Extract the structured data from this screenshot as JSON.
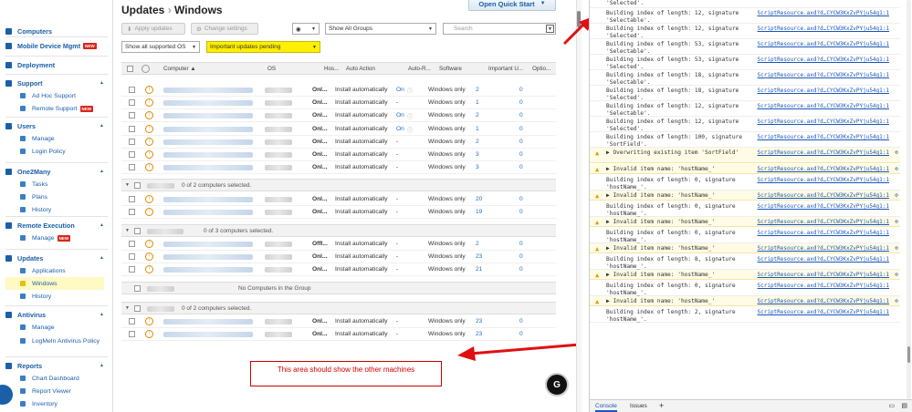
{
  "sidebar": {
    "sections": [
      {
        "label": "Computers",
        "items": []
      },
      {
        "label": "Mobile Device Mgmt",
        "badge": "NEW",
        "items": []
      },
      {
        "label": "Deployment",
        "items": []
      },
      {
        "label": "Support",
        "items": [
          {
            "label": "Ad Hoc Support"
          },
          {
            "label": "Remote Support",
            "badge": "NEW"
          }
        ]
      },
      {
        "label": "Users",
        "items": [
          {
            "label": "Manage"
          },
          {
            "label": "Login Policy"
          }
        ]
      },
      {
        "label": "One2Many",
        "items": [
          {
            "label": "Tasks"
          },
          {
            "label": "Plans"
          },
          {
            "label": "History"
          }
        ]
      },
      {
        "label": "Remote Execution",
        "items": [
          {
            "label": "Manage",
            "badge": "NEW"
          }
        ]
      },
      {
        "label": "Updates",
        "items": [
          {
            "label": "Applications"
          },
          {
            "label": "Windows",
            "active": true
          },
          {
            "label": "History"
          }
        ]
      },
      {
        "label": "Antivirus",
        "items": [
          {
            "label": "Manage"
          },
          {
            "label": "LogMeIn Antivirus Policy"
          }
        ]
      },
      {
        "label": "Reports",
        "items": [
          {
            "label": "Chart Dashboard"
          },
          {
            "label": "Report Viewer"
          },
          {
            "label": "Inventory"
          }
        ]
      }
    ]
  },
  "page": {
    "title": "Updates",
    "title_sep": "›",
    "subtitle": "Windows",
    "quick_start": "Open Quick Start"
  },
  "toolbar": {
    "apply": "Apply updates",
    "change": "Change settings",
    "group_select": "Show All Groups",
    "os_select": "Show all supported OS",
    "filter_select": "Important updates pending",
    "search_placeholder": "Search"
  },
  "table": {
    "headers": [
      "Computer ▲",
      "OS",
      "Hos...",
      "Auto Action",
      "Auto-R...",
      "Software",
      "Important U...",
      "Optio..."
    ],
    "rows": [
      {
        "status": "Onl...",
        "action": "Install automatically",
        "autor": "On",
        "autor_info": true,
        "software": "Windows only",
        "important": "2",
        "optional": "0"
      },
      {
        "status": "Onl...",
        "action": "Install automatically",
        "autor": "-",
        "autor_info": false,
        "software": "Windows only",
        "important": "1",
        "optional": "0"
      },
      {
        "status": "Onl...",
        "action": "Install automatically",
        "autor": "On",
        "autor_info": true,
        "software": "Windows only",
        "important": "2",
        "optional": "0"
      },
      {
        "status": "Onl...",
        "action": "Install automatically",
        "autor": "On",
        "autor_info": true,
        "software": "Windows only",
        "important": "1",
        "optional": "0"
      },
      {
        "status": "Onl...",
        "action": "Install automatically",
        "autor": "-",
        "autor_info": false,
        "software": "Windows only",
        "important": "2",
        "optional": "0"
      },
      {
        "status": "Onl...",
        "action": "Install automatically",
        "autor": "-",
        "autor_info": false,
        "software": "Windows only",
        "important": "3",
        "optional": "0"
      },
      {
        "status": "Onl...",
        "action": "Install automatically",
        "autor": "-",
        "autor_info": false,
        "software": "Windows only",
        "important": "3",
        "optional": "0"
      }
    ],
    "groups": [
      {
        "label": "0 of 2 computers selected.",
        "rows": [
          {
            "status": "Onl...",
            "action": "Install automatically",
            "autor": "-",
            "software": "Windows only",
            "important": "20",
            "optional": "0"
          },
          {
            "status": "Onl...",
            "action": "Install automatically",
            "autor": "-",
            "software": "Windows only",
            "important": "19",
            "optional": "0"
          }
        ]
      },
      {
        "label": "0 of 3 computers selected.",
        "rows": [
          {
            "status": "Offl...",
            "action": "Install automatically",
            "autor": "-",
            "software": "Windows only",
            "important": "2",
            "optional": "0"
          },
          {
            "status": "Onl...",
            "action": "Install automatically",
            "autor": "-",
            "software": "Windows only",
            "important": "23",
            "optional": "0"
          },
          {
            "status": "Onl...",
            "action": "Install automatically",
            "autor": "-",
            "software": "Windows only",
            "important": "21",
            "optional": "0"
          }
        ]
      },
      {
        "label": "No Computers in the Group",
        "rows": []
      },
      {
        "label": "0 of 2 computers selected.",
        "rows": [
          {
            "status": "Onl...",
            "action": "Install automatically",
            "autor": "-",
            "software": "Windows only",
            "important": "23",
            "optional": "0"
          },
          {
            "status": "Onl...",
            "action": "Install automatically",
            "autor": "-",
            "software": "Windows only",
            "important": "23",
            "optional": "0"
          }
        ]
      }
    ]
  },
  "annotation": {
    "text": "This area should show the other machines"
  },
  "devtools": {
    "logs": [
      {
        "type": "log",
        "text": "'Selected'.",
        "src": ""
      },
      {
        "type": "log",
        "text": "Building index of length: 12, signature 'Selectable'.",
        "src": "ScriptResource.axd?d…CYCW3KxZvPYju54g1:1"
      },
      {
        "type": "log",
        "text": "Building index of length: 12, signature 'Selected'.",
        "src": "ScriptResource.axd?d…CYCW3KxZvPYju54g1:1"
      },
      {
        "type": "log",
        "text": "Building index of length: 53, signature 'Selectable'.",
        "src": "ScriptResource.axd?d…CYCW3KxZvPYju54g1:1"
      },
      {
        "type": "log",
        "text": "Building index of length: 53, signature 'Selected'.",
        "src": "ScriptResource.axd?d…CYCW3KxZvPYju54g1:1"
      },
      {
        "type": "log",
        "text": "Building index of length: 18, signature 'Selectable'.",
        "src": "ScriptResource.axd?d…CYCW3KxZvPYju54g1:1"
      },
      {
        "type": "log",
        "text": "Building index of length: 18, signature 'Selected'.",
        "src": "ScriptResource.axd?d…CYCW3KxZvPYju54g1:1"
      },
      {
        "type": "log",
        "text": "Building index of length: 12, signature 'Selectable'.",
        "src": "ScriptResource.axd?d…CYCW3KxZvPYju54g1:1"
      },
      {
        "type": "log",
        "text": "Building index of length: 12, signature 'Selected'.",
        "src": "ScriptResource.axd?d…CYCW3KxZvPYju54g1:1"
      },
      {
        "type": "log",
        "text": "Building index of length: 100, signature 'SortField'.",
        "src": "ScriptResource.axd?d…CYCW3KxZvPYju54g1:1"
      },
      {
        "type": "warn",
        "text": "▶ Overwriting existing item 'SortField'",
        "src": "ScriptResource.axd?d…CYCW3KxZvPYju54g1:1"
      },
      {
        "type": "warn",
        "text": "▶ Invalid item name: 'hostName_'",
        "src": "ScriptResource.axd?d…CYCW3KxZvPYju54g1:1"
      },
      {
        "type": "log",
        "text": "Building index of length: 0, signature 'hostName_'.",
        "src": "ScriptResource.axd?d…CYCW3KxZvPYju54g1:1"
      },
      {
        "type": "warn",
        "text": "▶ Invalid item name: 'hostName_'",
        "src": "ScriptResource.axd?d…CYCW3KxZvPYju54g1:1"
      },
      {
        "type": "log",
        "text": "Building index of length: 0, signature 'hostName_'.",
        "src": "ScriptResource.axd?d…CYCW3KxZvPYju54g1:1"
      },
      {
        "type": "warn",
        "text": "▶ Invalid item name: 'hostName_'",
        "src": "ScriptResource.axd?d…CYCW3KxZvPYju54g1:1"
      },
      {
        "type": "log",
        "text": "Building index of length: 0, signature 'hostName_'.",
        "src": "ScriptResource.axd?d…CYCW3KxZvPYju54g1:1"
      },
      {
        "type": "warn",
        "text": "▶ Invalid item name: 'hostName_'",
        "src": "ScriptResource.axd?d…CYCW3KxZvPYju54g1:1"
      },
      {
        "type": "log",
        "text": "Building index of length: 8, signature 'hostName_'.",
        "src": "ScriptResource.axd?d…CYCW3KxZvPYju54g1:1"
      },
      {
        "type": "warn",
        "text": "▶ Invalid item name: 'hostName_'",
        "src": "ScriptResource.axd?d…CYCW3KxZvPYju54g1:1"
      },
      {
        "type": "log",
        "text": "Building index of length: 0, signature 'hostName_'.",
        "src": "ScriptResource.axd?d…CYCW3KxZvPYju54g1:1"
      },
      {
        "type": "warn",
        "text": "▶ Invalid item name: 'hostName_'",
        "src": "ScriptResource.axd?d…CYCW3KxZvPYju54g1:1"
      },
      {
        "type": "log",
        "text": "Building index of length: 2, signature 'hostName_'.",
        "src": "ScriptResource.axd?d…CYCW3KxZvPYju54g1:1"
      }
    ],
    "tabs": [
      "Console",
      "Issues"
    ]
  },
  "colors": {
    "accent": "#1a5fa8",
    "warning_bg": "#fffbe5",
    "highlight": "#ffef00",
    "badge": "#d9261c",
    "arrow": "#e01010"
  }
}
